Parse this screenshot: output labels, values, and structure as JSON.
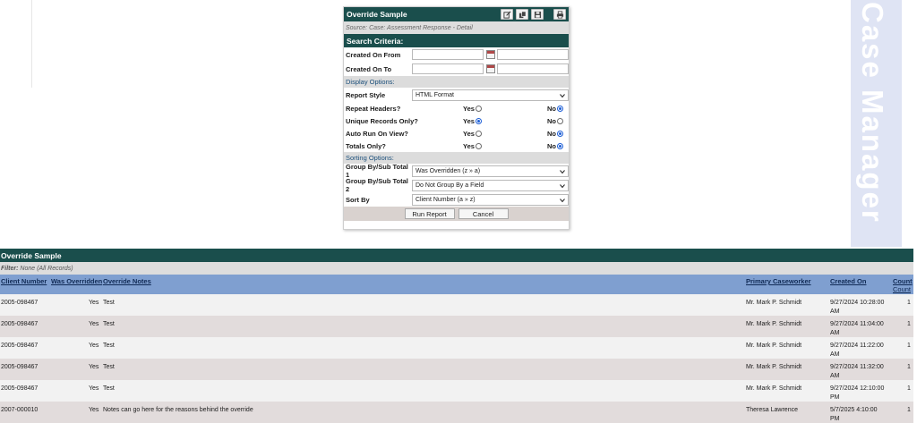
{
  "panel": {
    "title": "Override Sample",
    "source": "Source: Case: Assessment Response - Detail",
    "search_criteria": "Search Criteria:",
    "created_on_from": "Created On From",
    "created_on_to": "Created On To",
    "display_options": "Display Options:",
    "report_style_label": "Report Style",
    "report_style_value": "HTML Format",
    "repeat_headers": "Repeat Headers?",
    "unique_records": "Unique Records Only?",
    "auto_run": "Auto Run On View?",
    "totals_only": "Totals Only?",
    "yes": "Yes",
    "no": "No",
    "sorting_options": "Sorting Options:",
    "group1_label": "Group By/Sub Total 1",
    "group1_value": "Was Overridden (z » a)",
    "group2_label": "Group By/Sub Total 2",
    "group2_value": "Do Not Group By a Field",
    "sortby_label": "Sort By",
    "sortby_value": "Client Number (a » z)",
    "run_button": "Run Report",
    "cancel_button": "Cancel",
    "radios": {
      "repeat_headers": "no",
      "unique_records": "yes",
      "auto_run": "no",
      "totals_only": "no"
    }
  },
  "watermark": "Case Manager",
  "report": {
    "title": "Override Sample",
    "filter_label": "Filter:",
    "filter_value": "None (All Records)",
    "columns": {
      "client_number": "Client Number",
      "was_overridden": "Was Overridden",
      "override_notes": "Override Notes",
      "primary_caseworker": "Primary Caseworker",
      "created_on": "Created On",
      "count": "Count",
      "count2": "Count"
    },
    "rows": [
      {
        "client": "2005-098467",
        "overridden": "Yes",
        "notes": "Test",
        "caseworker": "Mr. Mark P. Schmidt",
        "created1": "9/27/2024 10:28:00",
        "created2": "AM",
        "count": "1"
      },
      {
        "client": "2005-098467",
        "overridden": "Yes",
        "notes": "Test",
        "caseworker": "Mr. Mark P. Schmidt",
        "created1": "9/27/2024 11:04:00",
        "created2": "AM",
        "count": "1"
      },
      {
        "client": "2005-098467",
        "overridden": "Yes",
        "notes": "Test",
        "caseworker": "Mr. Mark P. Schmidt",
        "created1": "9/27/2024 11:22:00",
        "created2": "AM",
        "count": "1"
      },
      {
        "client": "2005-098467",
        "overridden": "Yes",
        "notes": "Test",
        "caseworker": "Mr. Mark P. Schmidt",
        "created1": "9/27/2024 11:32:00",
        "created2": "AM",
        "count": "1"
      },
      {
        "client": "2005-098467",
        "overridden": "Yes",
        "notes": "Test",
        "caseworker": "Mr. Mark P. Schmidt",
        "created1": "9/27/2024 12:10:00",
        "created2": "PM",
        "count": "1"
      },
      {
        "client": "2007-000010",
        "overridden": "Yes",
        "notes": "Notes can go here for the reasons behind the override",
        "caseworker": "Theresa Lawrence",
        "created1": "5/7/2025 4:10:00",
        "created2": "PM",
        "count": "1"
      }
    ]
  }
}
